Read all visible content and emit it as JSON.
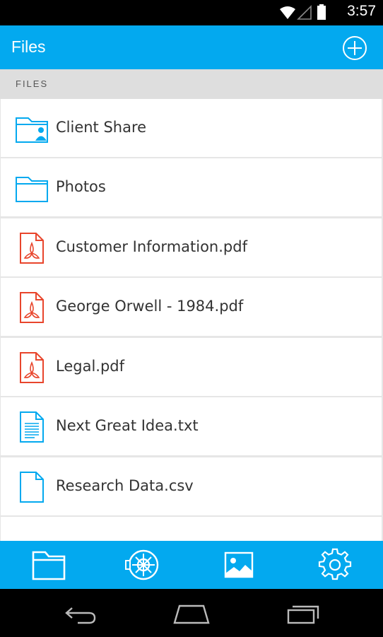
{
  "status_bar": {
    "time": "3:57"
  },
  "app_bar": {
    "title": "Files"
  },
  "section": {
    "header": "FILES"
  },
  "files": [
    {
      "name": "Client Share",
      "icon": "shared-folder-icon"
    },
    {
      "name": "Photos",
      "icon": "folder-icon"
    },
    {
      "name": "Customer Information.pdf",
      "icon": "pdf-icon"
    },
    {
      "name": "George Orwell - 1984.pdf",
      "icon": "pdf-icon"
    },
    {
      "name": "Legal.pdf",
      "icon": "pdf-icon"
    },
    {
      "name": "Next Great Idea.txt",
      "icon": "text-file-icon"
    },
    {
      "name": "Research Data.csv",
      "icon": "blank-file-icon"
    }
  ],
  "tabs": [
    {
      "name": "files-tab",
      "icon": "folder-icon",
      "selected": true
    },
    {
      "name": "secure-tab",
      "icon": "ship-wheel-icon",
      "selected": false
    },
    {
      "name": "photos-tab",
      "icon": "image-icon",
      "selected": false
    },
    {
      "name": "settings-tab",
      "icon": "gear-icon",
      "selected": false
    }
  ],
  "colors": {
    "accent": "#03a9ef",
    "pdf": "#e8452c",
    "section_bg": "#dedede"
  }
}
